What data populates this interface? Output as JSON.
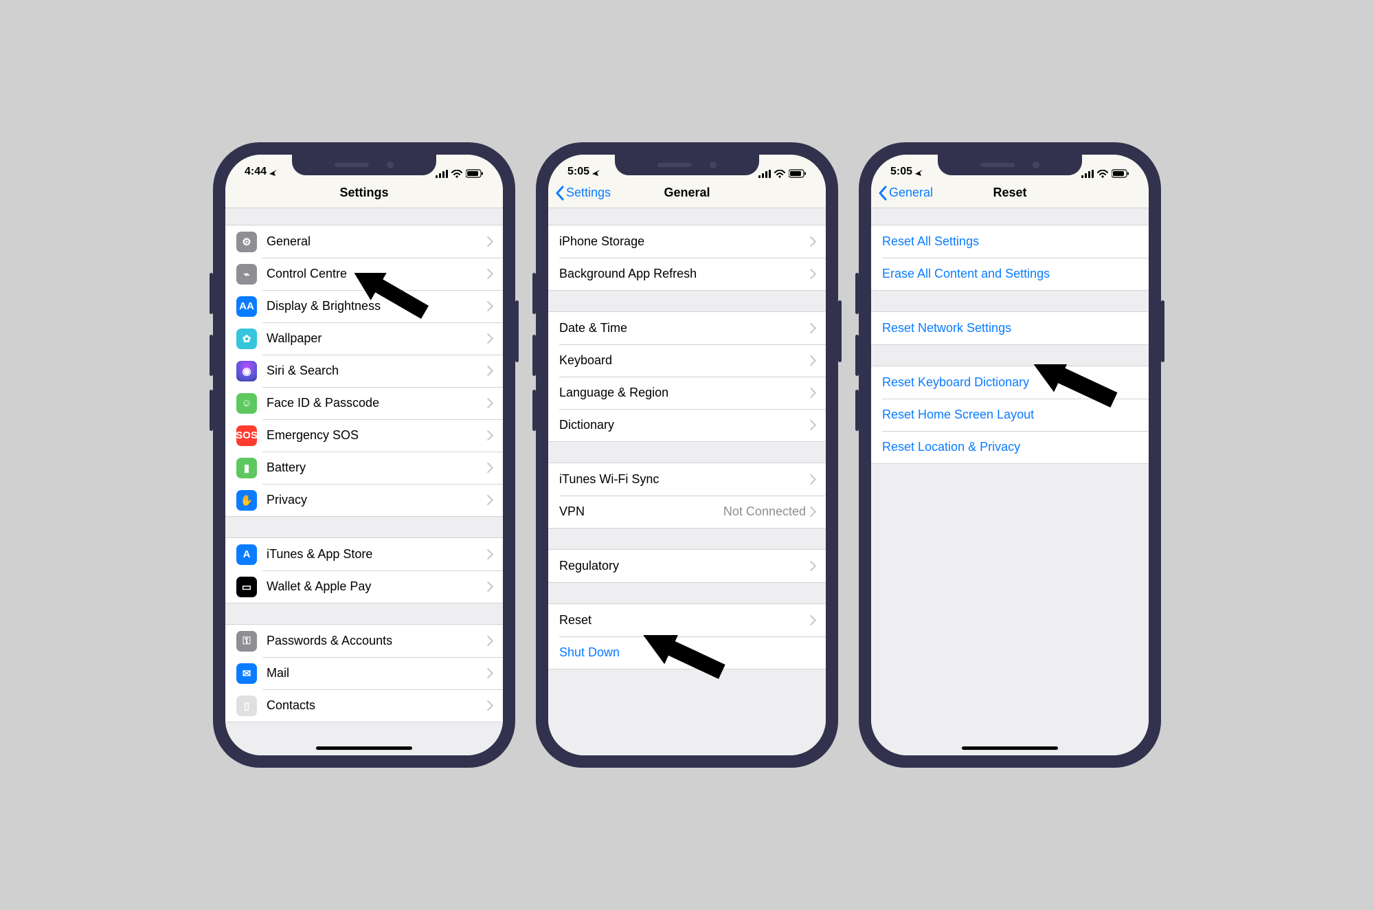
{
  "phones": {
    "settings": {
      "time": "4:44",
      "title": "Settings",
      "groups": [
        [
          {
            "key": "general",
            "label": "General",
            "icon": "gear"
          },
          {
            "key": "control",
            "label": "Control Centre",
            "icon": "control"
          },
          {
            "key": "display",
            "label": "Display & Brightness",
            "icon": "display"
          },
          {
            "key": "wallpaper",
            "label": "Wallpaper",
            "icon": "wall"
          },
          {
            "key": "siri",
            "label": "Siri & Search",
            "icon": "siri"
          },
          {
            "key": "faceid",
            "label": "Face ID & Passcode",
            "icon": "face"
          },
          {
            "key": "sos",
            "label": "Emergency SOS",
            "icon": "sos"
          },
          {
            "key": "battery",
            "label": "Battery",
            "icon": "batt"
          },
          {
            "key": "privacy",
            "label": "Privacy",
            "icon": "priv"
          }
        ],
        [
          {
            "key": "itunes",
            "label": "iTunes & App Store",
            "icon": "store"
          },
          {
            "key": "wallet",
            "label": "Wallet & Apple Pay",
            "icon": "wallet"
          }
        ],
        [
          {
            "key": "passwords",
            "label": "Passwords & Accounts",
            "icon": "pass"
          },
          {
            "key": "mail",
            "label": "Mail",
            "icon": "mail"
          },
          {
            "key": "contacts",
            "label": "Contacts",
            "icon": "contacts"
          }
        ]
      ]
    },
    "general": {
      "time": "5:05",
      "back": "Settings",
      "title": "General",
      "groups": [
        [
          {
            "key": "storage",
            "label": "iPhone Storage"
          },
          {
            "key": "bg",
            "label": "Background App Refresh"
          }
        ],
        [
          {
            "key": "date",
            "label": "Date & Time"
          },
          {
            "key": "kbd",
            "label": "Keyboard"
          },
          {
            "key": "lang",
            "label": "Language & Region"
          },
          {
            "key": "dict",
            "label": "Dictionary"
          }
        ],
        [
          {
            "key": "ituneswifi",
            "label": "iTunes Wi-Fi Sync"
          },
          {
            "key": "vpn",
            "label": "VPN",
            "value": "Not Connected"
          }
        ],
        [
          {
            "key": "reg",
            "label": "Regulatory"
          }
        ],
        [
          {
            "key": "reset",
            "label": "Reset"
          },
          {
            "key": "shutdown",
            "label": "Shut Down",
            "link": true,
            "nochev": true
          }
        ]
      ]
    },
    "reset": {
      "time": "5:05",
      "back": "General",
      "title": "Reset",
      "groups": [
        [
          {
            "key": "allsettings",
            "label": "Reset All Settings",
            "link": true,
            "nochev": true
          },
          {
            "key": "eraseall",
            "label": "Erase All Content and Settings",
            "link": true,
            "nochev": true
          }
        ],
        [
          {
            "key": "network",
            "label": "Reset Network Settings",
            "link": true,
            "nochev": true
          }
        ],
        [
          {
            "key": "kbddict",
            "label": "Reset Keyboard Dictionary",
            "link": true,
            "nochev": true
          },
          {
            "key": "home",
            "label": "Reset Home Screen Layout",
            "link": true,
            "nochev": true
          },
          {
            "key": "loc",
            "label": "Reset Location & Privacy",
            "link": true,
            "nochev": true
          }
        ]
      ]
    }
  },
  "icons": {
    "gear": "⚙︎",
    "control": "⌁",
    "display": "AA",
    "wall": "✿",
    "siri": "◉",
    "face": "☺︎",
    "sos": "SOS",
    "batt": "▮",
    "priv": "✋",
    "store": "A",
    "wallet": "▭",
    "pass": "⚿",
    "mail": "✉︎",
    "contacts": "▯"
  }
}
